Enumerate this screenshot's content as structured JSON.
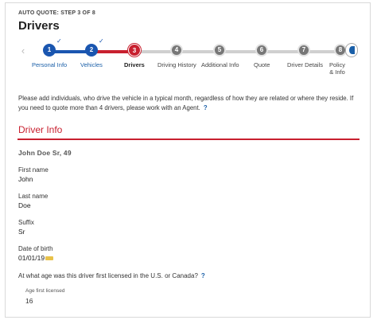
{
  "header": {
    "step_label": "AUTO QUOTE: STEP 3 OF 8",
    "title": "Drivers"
  },
  "progress": {
    "steps": [
      {
        "number": "1",
        "label": "Personal Info",
        "status": "done"
      },
      {
        "number": "2",
        "label": "Vehicles",
        "status": "done"
      },
      {
        "number": "3",
        "label": "Drivers",
        "status": "current"
      },
      {
        "number": "4",
        "label": "Driving History",
        "status": "todo"
      },
      {
        "number": "5",
        "label": "Additional Info",
        "status": "todo"
      },
      {
        "number": "6",
        "label": "Quote",
        "status": "todo"
      },
      {
        "number": "7",
        "label": "Driver Details",
        "status": "todo"
      },
      {
        "number": "8",
        "label": "Policy & Info",
        "status": "todo"
      }
    ],
    "check_mark": "✓",
    "nav_prev": "‹"
  },
  "intro": {
    "text": "Please add individuals, who drive the vehicle in a typical month, regardless of how they are related or where they reside. If you need to quote more than 4 drivers, please work with an Agent.",
    "help": "?"
  },
  "section": {
    "title": "Driver Info"
  },
  "driver": {
    "heading": "John Doe Sr, 49",
    "fields": [
      {
        "label": "First name",
        "value": "John"
      },
      {
        "label": "Last name",
        "value": "Doe"
      },
      {
        "label": "Suffix",
        "value": "Sr"
      },
      {
        "label": "Date of birth",
        "value": "01/01/19"
      }
    ]
  },
  "license_question": {
    "text": "At what age was this driver first licensed in the U.S. or Canada?",
    "help": "?",
    "input_label": "Age first licensed",
    "input_value": "16"
  },
  "colors": {
    "accent_red": "#c8202f",
    "accent_blue": "#1a56b0",
    "todo_gray": "#777777"
  }
}
